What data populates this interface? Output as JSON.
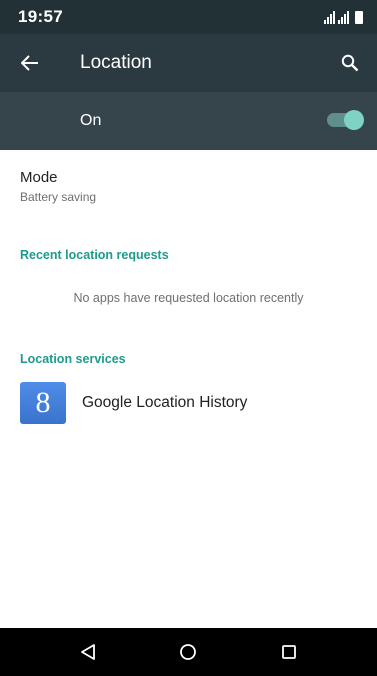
{
  "status_bar": {
    "time": "19:57"
  },
  "toolbar": {
    "title": "Location",
    "back_icon": "arrow-left-icon",
    "search_icon": "search-icon"
  },
  "switch_bar": {
    "label": "On",
    "toggle_state": "on",
    "accent_color": "#7fd3c4"
  },
  "mode": {
    "title": "Mode",
    "summary": "Battery saving"
  },
  "recent_requests": {
    "header": "Recent location requests",
    "empty_text": "No apps have requested location recently"
  },
  "location_services": {
    "header": "Location services",
    "items": [
      {
        "label": "Google Location History",
        "icon": "google-settings-icon",
        "icon_glyph": "8"
      }
    ]
  },
  "colors": {
    "section_header": "#1e9b8c",
    "toolbar": "#2b3a40",
    "status_bar": "#223136",
    "switch_bar": "#36454c"
  },
  "nav_bar": {
    "icons": [
      "back-triangle-icon",
      "home-circle-icon",
      "recents-square-icon"
    ]
  }
}
